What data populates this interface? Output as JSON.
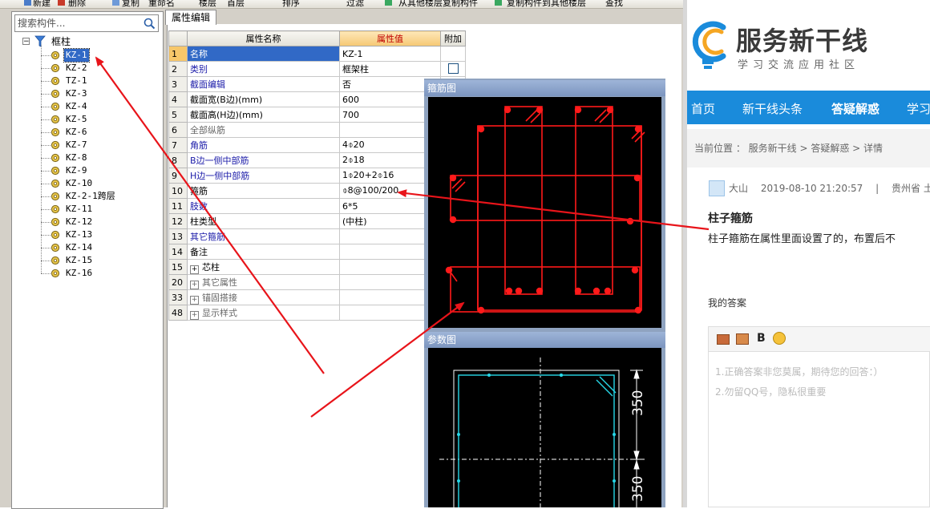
{
  "toolbar": {
    "items": [
      "新建",
      "删除",
      "复制",
      "重命名",
      "楼层",
      "首层",
      "排序",
      "过滤",
      "从其他楼层复制构件",
      "复制构件到其他楼层",
      "查找"
    ]
  },
  "search": {
    "placeholder": "搜索构件..."
  },
  "tree": {
    "root": "框柱",
    "items": [
      "KZ-1",
      "KZ-2",
      "TZ-1",
      "KZ-3",
      "KZ-4",
      "KZ-5",
      "KZ-6",
      "KZ-7",
      "KZ-8",
      "KZ-9",
      "KZ-10",
      "KZ-2-1跨层",
      "KZ-11",
      "KZ-12",
      "KZ-13",
      "KZ-14",
      "KZ-15",
      "KZ-16"
    ],
    "selected_index": 0
  },
  "props": {
    "tab": "属性编辑",
    "headers": {
      "name": "属性名称",
      "value": "属性值",
      "extra": "附加"
    },
    "rows": [
      {
        "n": "1",
        "name": "名称",
        "value": "KZ-1"
      },
      {
        "n": "2",
        "name": "类别",
        "value": "框架柱"
      },
      {
        "n": "3",
        "name": "截面编辑",
        "value": "否"
      },
      {
        "n": "4",
        "name": "截面宽(B边)(mm)",
        "value": "600"
      },
      {
        "n": "5",
        "name": "截面高(H边)(mm)",
        "value": "700"
      },
      {
        "n": "6",
        "name": "全部纵筋",
        "value": ""
      },
      {
        "n": "7",
        "name": "角筋",
        "value": "4⌽20"
      },
      {
        "n": "8",
        "name": "B边一侧中部筋",
        "value": "2⌽18"
      },
      {
        "n": "9",
        "name": "H边一侧中部筋",
        "value": "1⌽20+2⌽16"
      },
      {
        "n": "10",
        "name": "箍筋",
        "value": "⌽8@100/200"
      },
      {
        "n": "11",
        "name": "肢数",
        "value": "6*5"
      },
      {
        "n": "12",
        "name": "柱类型",
        "value": "(中柱)"
      },
      {
        "n": "13",
        "name": "其它箍筋",
        "value": ""
      },
      {
        "n": "14",
        "name": "备注",
        "value": ""
      },
      {
        "n": "15",
        "name": "芯柱",
        "value": ""
      },
      {
        "n": "20",
        "name": "其它属性",
        "value": ""
      },
      {
        "n": "33",
        "name": "锚固搭接",
        "value": ""
      },
      {
        "n": "48",
        "name": "显示样式",
        "value": ""
      }
    ]
  },
  "figures": {
    "stirrup_title": "箍筋图",
    "param_title": "参数图",
    "dim1": "350",
    "dim2": "350"
  },
  "site": {
    "brand": "服务新干线",
    "slogan": "学习交流应用社区",
    "nav": [
      "首页",
      "新干线头条",
      "答疑解惑",
      "学习"
    ],
    "crumb": "当前位置 ： 服务新干线 > 答疑解惑 > 详情",
    "user": "大山",
    "time": "2019-08-10 21:20:57",
    "sep": "|",
    "location": "贵州省  土",
    "q_title": "柱子箍筋",
    "q_body": "柱子箍筋在属性里面设置了的，布置后不",
    "my_answer": "我的答案",
    "hint1": "1.正确答案非您莫属，期待您的回答：）",
    "hint2": "2.勿留QQ号，隐私很重要",
    "bold_btn": "B"
  },
  "colors": {
    "accent": "#1a8bdb",
    "arrow": "#e8141a",
    "rebar": "#ff1a1a",
    "param": "#27d8e8"
  }
}
